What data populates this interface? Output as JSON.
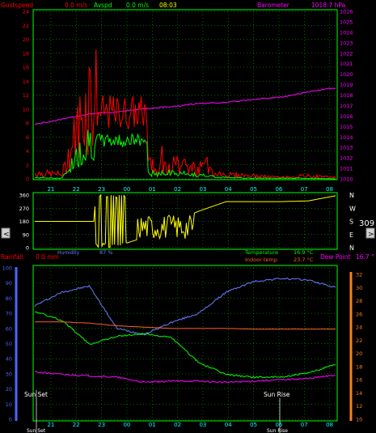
{
  "colors": {
    "gust": "#ff0000",
    "avg": "#00ff00",
    "baro": "#ff00ff",
    "axis_left": "#ff0000",
    "axis_right": "#ff00ff",
    "grid": "#00ff00",
    "time": "#00ffff",
    "dir": "#ffff00",
    "humidity": "#6a7cff",
    "temp": "#00ff00",
    "indoor": "#ff5a2a",
    "dew": "#ff00ff",
    "rain": "#ff0000",
    "rain_axis": "#4a66ff",
    "temp_axis": "#ff7f1a"
  },
  "header": {
    "gust_label": "Gustspeed",
    "gust_value": "0.0 m/s",
    "avg_label": "Avspd",
    "avg_value": "0.0 m/s",
    "time": "08:03",
    "baro_label": "Barometer",
    "baro_value": "1018.7 hPa"
  },
  "time_labels": [
    "21",
    "22",
    "23",
    "00",
    "01",
    "02",
    "03",
    "04",
    "05",
    "06",
    "07",
    "08"
  ],
  "wind_panel": {
    "left_ticks": [
      "0",
      "2",
      "4",
      "6",
      "8",
      "10",
      "12",
      "14",
      "16",
      "18",
      "20",
      "22",
      "24"
    ],
    "right_ticks": [
      "1010",
      "1011",
      "1012",
      "1013",
      "1014",
      "1015",
      "1016",
      "1017",
      "1018",
      "1019",
      "1020",
      "1021",
      "1022",
      "1023",
      "1024",
      "1025",
      "1026"
    ]
  },
  "dir_panel": {
    "left_ticks": [
      "0",
      "90",
      "180",
      "270",
      "360"
    ],
    "compass": [
      "N",
      "W",
      "S",
      "E",
      "N"
    ],
    "current_dir": "309",
    "nav_left": "<",
    "nav_right": ">"
  },
  "mid_labels": {
    "rain_label": "Rainfall",
    "rain_value": "0.0 mm",
    "humidity_label": "Humidity",
    "humidity_value": "87 %",
    "temp_label": "Temperature",
    "temp_value": "16.9 °C",
    "indoor_label": "Indoor temp",
    "indoor_value": "23.7 °C",
    "dew_label": "Dew Point",
    "dew_value": "16.7 °"
  },
  "climate_panel": {
    "left_ticks": [
      "0",
      "10",
      "20",
      "30",
      "40",
      "50",
      "60",
      "70",
      "80",
      "90",
      "100"
    ],
    "right_ticks": [
      "10",
      "12",
      "14",
      "16",
      "18",
      "20",
      "22",
      "24",
      "26",
      "28",
      "30",
      "32"
    ],
    "sun_set": "Sun Set",
    "sun_rise": "Sun Rise"
  },
  "chart_data": [
    {
      "type": "line",
      "x": [
        "21",
        "22",
        "23",
        "00",
        "01",
        "02",
        "03",
        "04",
        "05",
        "06",
        "07",
        "08"
      ],
      "series": [
        {
          "name": "Gustspeed",
          "axis": "left",
          "values": [
            0.8,
            0.6,
            11.4,
            10.4,
            1.8,
            2.0,
            1.4,
            0.6,
            0.4,
            0.2,
            0.4,
            0.2
          ]
        },
        {
          "name": "Avspd",
          "axis": "left",
          "values": [
            0.2,
            0.1,
            6.4,
            5.2,
            0.8,
            1.0,
            0.6,
            0.2,
            0.1,
            0.1,
            0.1,
            0.0
          ]
        },
        {
          "name": "Barometer",
          "axis": "right",
          "values": [
            1015.2,
            1015.7,
            1016.2,
            1016.4,
            1016.7,
            1016.9,
            1017.2,
            1017.3,
            1017.6,
            1017.8,
            1018.3,
            1018.7
          ]
        }
      ],
      "ylim_left": [
        0,
        24
      ],
      "ylim_right": [
        1010,
        1026
      ],
      "grid": true
    },
    {
      "type": "line",
      "x": [
        "21",
        "22",
        "23",
        "00",
        "01",
        "02",
        "03",
        "04",
        "05",
        "06",
        "07",
        "08"
      ],
      "series": [
        {
          "name": "Wind direction",
          "values": [
            180,
            180,
            350,
            10,
            70,
            170,
            250,
            315,
            315,
            315,
            320,
            355
          ]
        }
      ],
      "ylim": [
        0,
        360
      ],
      "grid": true
    },
    {
      "type": "line",
      "x": [
        "21",
        "22",
        "23",
        "00",
        "01",
        "02",
        "03",
        "04",
        "05",
        "06",
        "07",
        "08"
      ],
      "series": [
        {
          "name": "Humidity",
          "axis": "left",
          "values": [
            75,
            84,
            88,
            60,
            56,
            64,
            70,
            84,
            91,
            93,
            92,
            87
          ]
        },
        {
          "name": "Temperature",
          "axis": "right",
          "values": [
            26.4,
            25.0,
            21.4,
            22.6,
            23.0,
            22.4,
            18.6,
            16.8,
            16.4,
            16.4,
            17.0,
            18.4
          ]
        },
        {
          "name": "Indoor temp",
          "axis": "right",
          "values": [
            24.8,
            24.8,
            24.6,
            24.2,
            24.0,
            23.8,
            23.8,
            23.8,
            23.7,
            23.7,
            23.7,
            23.7
          ]
        },
        {
          "name": "Dew Point",
          "axis": "right",
          "values": [
            17.2,
            16.8,
            16.6,
            16.4,
            15.6,
            15.8,
            15.8,
            15.6,
            15.8,
            16.0,
            16.2,
            16.7
          ]
        }
      ],
      "ylim_left": [
        0,
        100
      ],
      "ylim_right": [
        10,
        33
      ],
      "grid": true
    }
  ]
}
